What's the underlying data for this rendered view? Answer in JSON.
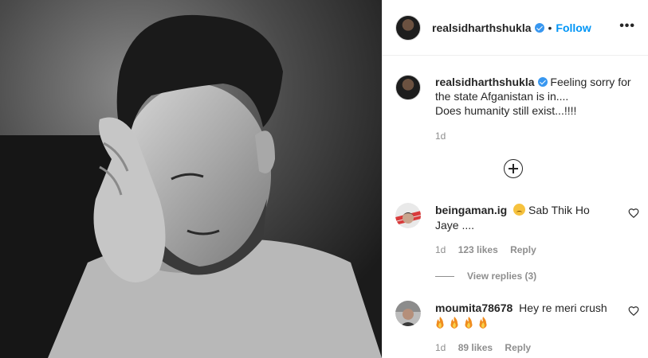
{
  "post": {
    "author": "realsidharthshukla",
    "verified": true,
    "separator": "•",
    "follow_label": "Follow",
    "more_label": "•••",
    "caption": "Feeling sorry for\nthe state Afganistan is in....\nDoes humanity still exist...!!!!",
    "caption_time": "1d"
  },
  "comments": [
    {
      "username": "beingaman.ig",
      "text": "Sab Thik Ho\nJaye ....",
      "emoji": "sad-face",
      "time": "1d",
      "likes": "123 likes",
      "reply_label": "Reply",
      "view_replies": "View replies (3)"
    },
    {
      "username": "moumita78678",
      "text": "Hey re meri crush",
      "emoji": "fire x4",
      "time": "1d",
      "likes": "89 likes",
      "reply_label": "Reply"
    }
  ],
  "colors": {
    "accent": "#0095f6",
    "verified": "#3897f0",
    "secondary_text": "#8e8e8e",
    "border": "#efefef"
  },
  "icons": {
    "more": "more-horizontal-icon",
    "load_more": "plus-circle-icon",
    "like": "heart-icon",
    "verified": "verified-badge-icon"
  }
}
